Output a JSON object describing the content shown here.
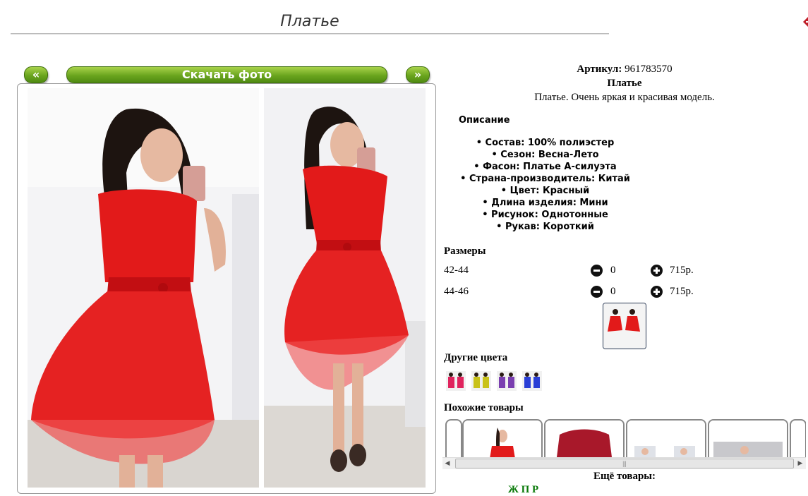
{
  "header": {
    "title": "Платье"
  },
  "gallery": {
    "prev_label": "«",
    "download_label": "Скачать фото",
    "next_label": "»"
  },
  "product": {
    "article_label": "Артикул:",
    "article_value": "961783570",
    "name": "Платье",
    "short_description": "Платье. Очень яркая и красивая модель.",
    "description_heading": "Описание",
    "description_items": [
      "• Состав: 100% полиэстер",
      "• Сезон: Весна-Лето",
      "• Фасон: Платье А-силуэта",
      "• Страна-производитель: Китай",
      "• Цвет: Красный",
      "• Длина изделия: Мини",
      "• Рисунок: Однотонные",
      "• Рукав: Короткий"
    ]
  },
  "sizes": {
    "heading": "Размеры",
    "rows": [
      {
        "size": "42-44",
        "qty": "0",
        "price": "715р."
      },
      {
        "size": "44-46",
        "qty": "0",
        "price": "715р."
      }
    ]
  },
  "other_colors": {
    "heading": "Другие цвета",
    "swatches": [
      "#e0245e",
      "#c9c21a",
      "#7a3fb0",
      "#2a3fd6"
    ]
  },
  "similar": {
    "heading": "Похожие товары"
  },
  "more": {
    "heading": "Ещё товары:",
    "links_text": "Ж                    П          Р"
  },
  "colors": {
    "accent_green": "#6aa51e",
    "dress_red": "#e21a1a",
    "close_red": "#c0202a"
  }
}
